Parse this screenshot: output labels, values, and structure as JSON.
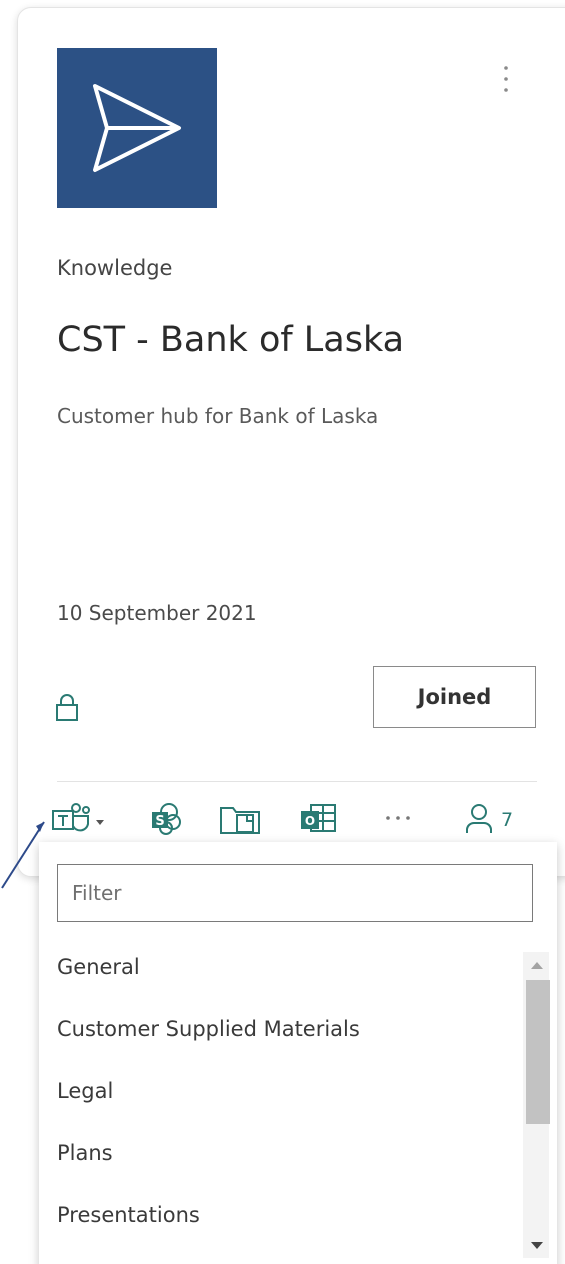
{
  "card": {
    "category": "Knowledge",
    "title": "CST - Bank of Laska",
    "description": "Customer hub for Bank of Laska",
    "date": "10 September 2021",
    "join_label": "Joined",
    "member_count": "7",
    "logo_color": "#2c5185",
    "accent_color": "#2a7a73"
  },
  "toolbar": {
    "icons": [
      "teams-icon",
      "sharepoint-icon",
      "files-icon",
      "outlook-icon",
      "more-icon",
      "members-icon"
    ]
  },
  "channel_dropdown": {
    "filter_placeholder": "Filter",
    "channels": [
      "General",
      "Customer Supplied Materials",
      "Legal",
      "Plans",
      "Presentations"
    ]
  }
}
